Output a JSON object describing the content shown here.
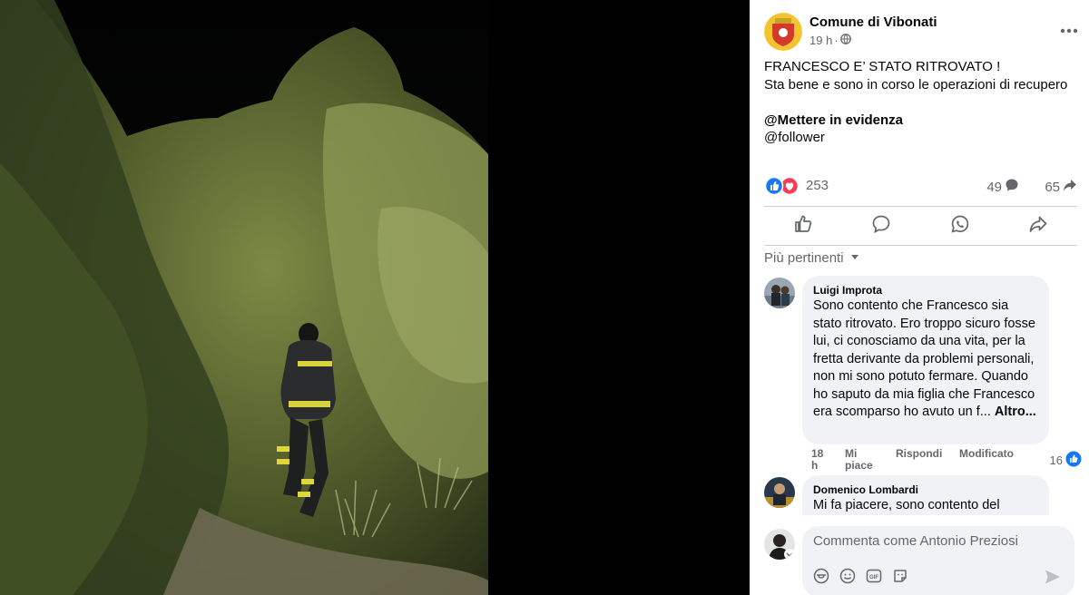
{
  "post": {
    "page_name": "Comune di Vibonati",
    "time": "19 h",
    "visibility_sep": "·",
    "lines": [
      "FRANCESCO E’ STATO RITROVATO !",
      "Sta bene e sono in corso le operazioni di recupero"
    ],
    "mention_1": "@Mettere in evidenza",
    "mention_2": "@follower",
    "reactions_count": "253",
    "comments_count": "49",
    "shares_count": "65"
  },
  "sort": {
    "label": "Più pertinenti"
  },
  "comments": [
    {
      "author": "Luigi Improta",
      "text": "Sono contento che Francesco sia stato ritrovato. Ero troppo sicuro fosse lui, ci conosciamo da una vita, per la fretta derivante da problemi personali, non mi sono potuto fermare. Quando ho saputo da mia figlia che Francesco era scomparso ho avuto un f...",
      "more": "Altro...",
      "time": "18 h",
      "like": "Mi piace",
      "reply": "Rispondi",
      "edited": "Modificato",
      "likes": "16"
    },
    {
      "author": "Domenico Lombardi",
      "text": "Mi fa piacere, sono contento del"
    }
  ],
  "composer": {
    "placeholder": "Commenta come Antonio Preziosi"
  },
  "colors": {
    "like_blue": "#1877f2",
    "love_red": "#f33e58",
    "text_secondary": "#65676b",
    "bubble_bg": "#f0f2f5"
  },
  "icons": [
    "globe-icon",
    "more-icon",
    "like-icon",
    "comment-icon",
    "whatsapp-icon",
    "share-icon",
    "sort-caret-icon",
    "sticker-icon",
    "emoji-icon",
    "gif-icon",
    "camera-sticker-icon",
    "send-icon"
  ]
}
